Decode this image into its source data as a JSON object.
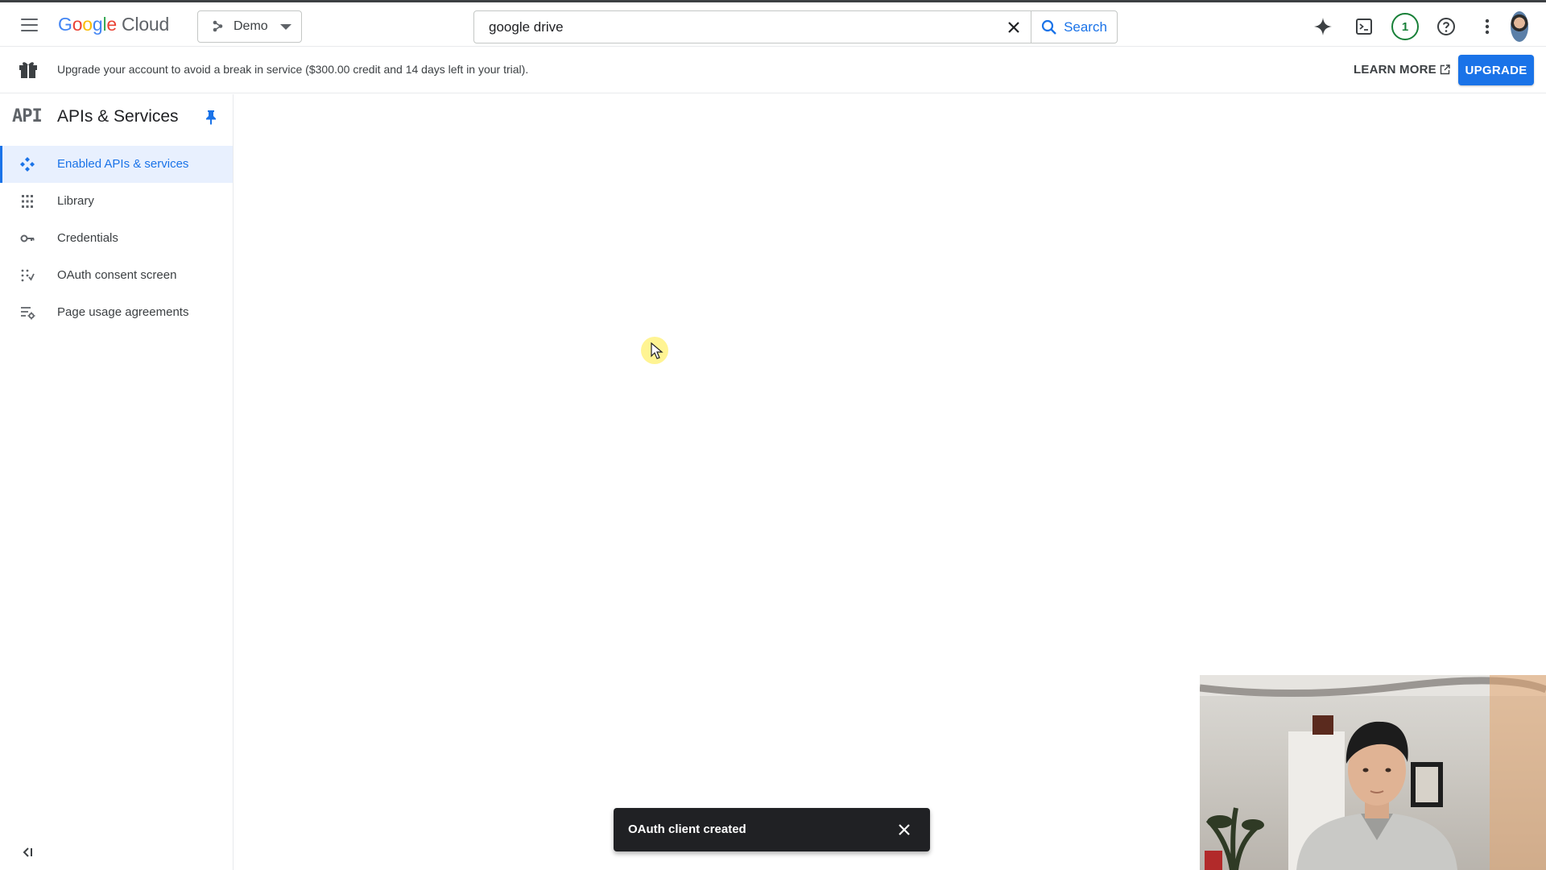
{
  "header": {
    "logo": {
      "google_letters": [
        "G",
        "o",
        "o",
        "g",
        "l",
        "e"
      ],
      "product": "Cloud"
    },
    "project_name": "Demo",
    "search": {
      "value": "google drive",
      "button_label": "Search"
    },
    "notification_count": "1",
    "icons": [
      "menu-icon",
      "sparkle-icon",
      "terminal-icon",
      "help-icon",
      "more-vert-icon"
    ]
  },
  "banner": {
    "message": "Upgrade your account to avoid a break in service ($300.00 credit and 14 days left in your trial).",
    "learn_more_label": "LEARN MORE",
    "upgrade_label": "UPGRADE"
  },
  "sidebar": {
    "logo_text": "API",
    "title": "APIs & Services",
    "items": [
      {
        "label": "Enabled APIs & services",
        "icon": "hub-icon",
        "active": true
      },
      {
        "label": "Library",
        "icon": "library-icon",
        "active": false
      },
      {
        "label": "Credentials",
        "icon": "key-icon",
        "active": false
      },
      {
        "label": "OAuth consent screen",
        "icon": "consent-icon",
        "active": false
      },
      {
        "label": "Page usage agreements",
        "icon": "settings-list-icon",
        "active": false
      }
    ]
  },
  "snackbar": {
    "message": "OAuth client created"
  },
  "colors": {
    "accent": "#1a73e8",
    "active_bg": "#e8f0fe",
    "snackbar_bg": "#202124",
    "notification_green": "#188038"
  }
}
